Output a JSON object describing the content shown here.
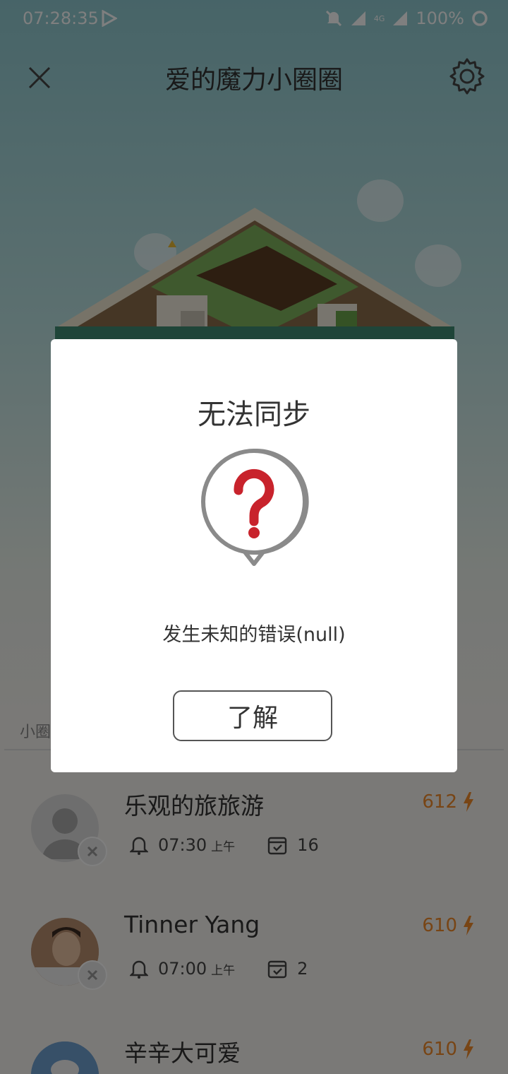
{
  "status_bar": {
    "time": "07:28:35",
    "network": "4G",
    "battery": "100%"
  },
  "header": {
    "title": "爱的魔力小圈圈"
  },
  "section": {
    "label": "小圈"
  },
  "members": [
    {
      "name": "乐观的旅旅游",
      "score": "612",
      "alarm_time": "07:30",
      "ampm": "上午",
      "days": "16",
      "avatar": "default"
    },
    {
      "name": "Tinner Yang",
      "score": "610",
      "alarm_time": "07:00",
      "ampm": "上午",
      "days": "2",
      "avatar": "photo"
    },
    {
      "name": "辛辛大可爱",
      "score": "610",
      "avatar": "photo"
    }
  ],
  "dialog": {
    "title": "无法同步",
    "message": "发生未知的错误(null)",
    "button": "了解",
    "icon": "question-bubble-icon"
  },
  "colors": {
    "accent_orange": "#f08a2a",
    "error_red": "#c8232c"
  }
}
